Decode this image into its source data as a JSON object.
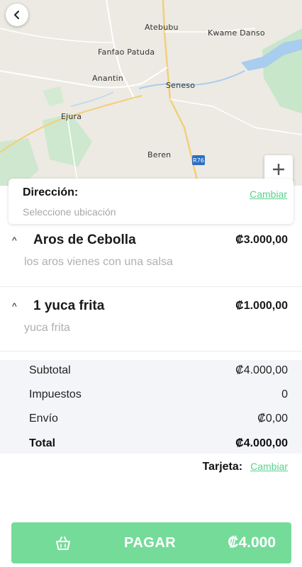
{
  "map": {
    "labels": [
      "Atebubu",
      "Kwame Danso",
      "Fanfao Patuda",
      "Anantin",
      "Seneso",
      "Ejura",
      "Beren"
    ],
    "road_badge": "R76",
    "zoom_in": "+"
  },
  "address": {
    "title": "Dirección:",
    "placeholder": "Seleccione ubicación",
    "change_label": "Cambiar"
  },
  "items": [
    {
      "name": "Aros de Cebolla",
      "price": "₡3.000,00",
      "description": "los aros vienes con una salsa",
      "chevron": "^"
    },
    {
      "name": "1 yuca frita",
      "price": "₡1.000,00",
      "description": "yuca frita",
      "chevron": "^"
    }
  ],
  "summary": {
    "subtotal_label": "Subtotal",
    "subtotal_value": "₡4.000,00",
    "tax_label": "Impuestos",
    "tax_value": "0",
    "shipping_label": "Envío",
    "shipping_value": "₡0,00",
    "total_label": "Total",
    "total_value": "₡4.000,00"
  },
  "payment": {
    "label": "Tarjeta:",
    "change_label": "Cambiar"
  },
  "pay_button": {
    "label": "PAGAR",
    "amount": "₡4.000",
    "icon": "basket-icon"
  },
  "colors": {
    "accent": "#57d18d",
    "button": "#75db99",
    "summary_bg": "#f4f5f8"
  }
}
